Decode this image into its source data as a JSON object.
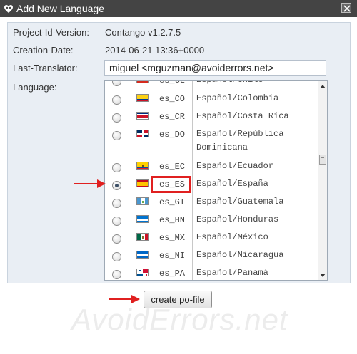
{
  "window": {
    "title": "Add New Language",
    "logo_icon": "plugin-logo-icon",
    "close_icon": "close-icon"
  },
  "meta": {
    "project_label": "Project-Id-Version:",
    "project_value": "Contango v1.2.7.5",
    "creation_label": "Creation-Date:",
    "creation_value": "2014-06-21 13:36+0000",
    "translator_label": "Last-Translator:",
    "translator_value": "miguel <mguzman@avoiderrors.net>",
    "language_label": "Language:"
  },
  "languages": [
    {
      "code": "es_CL",
      "name": "Español/Chile",
      "checked": false,
      "flag": "cl"
    },
    {
      "code": "es_CO",
      "name": "Español/Colombia",
      "checked": false,
      "flag": "co"
    },
    {
      "code": "es_CR",
      "name": "Español/Costa Rica",
      "checked": false,
      "flag": "cr"
    },
    {
      "code": "es_DO",
      "name": "Español/República Dominicana",
      "checked": false,
      "flag": "do"
    },
    {
      "code": "es_EC",
      "name": "Español/Ecuador",
      "checked": false,
      "flag": "ec"
    },
    {
      "code": "es_ES",
      "name": "Español/España",
      "checked": true,
      "flag": "es"
    },
    {
      "code": "es_GT",
      "name": "Español/Guatemala",
      "checked": false,
      "flag": "gt"
    },
    {
      "code": "es_HN",
      "name": "Español/Honduras",
      "checked": false,
      "flag": "hn"
    },
    {
      "code": "es_MX",
      "name": "Español/México",
      "checked": false,
      "flag": "mx"
    },
    {
      "code": "es_NI",
      "name": "Español/Nicaragua",
      "checked": false,
      "flag": "ni"
    },
    {
      "code": "es_PA",
      "name": "Español/Panamá",
      "checked": false,
      "flag": "pa"
    }
  ],
  "actions": {
    "create_label": "create po-file"
  },
  "watermark": "AvoidErrors.net",
  "colors": {
    "titlebar": "#444444",
    "panel": "#e9eef4",
    "annotation_red": "#e02020"
  }
}
